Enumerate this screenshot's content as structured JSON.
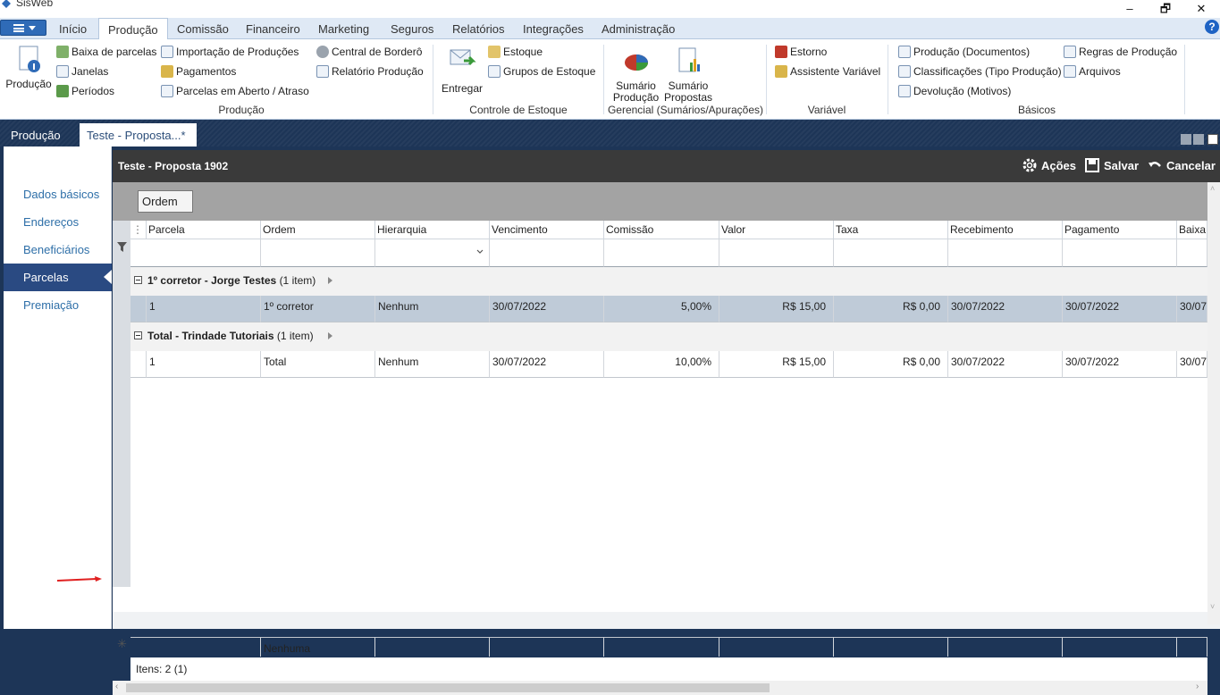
{
  "app": {
    "title": "SisWeb"
  },
  "window": {
    "minimize": "‒",
    "restore": "🗗",
    "close": "✕"
  },
  "ribbon_tabs": [
    "Início",
    "Produção",
    "Comissão",
    "Financeiro",
    "Marketing",
    "Seguros",
    "Relatórios",
    "Integrações",
    "Administração"
  ],
  "ribbon": {
    "producao_big": "Produção",
    "col1": [
      "Baixa de parcelas",
      "Janelas",
      "Períodos"
    ],
    "col2": [
      "Importação de Produções",
      "Pagamentos",
      "Parcelas em Aberto / Atraso"
    ],
    "col3": [
      "Central de Borderô",
      "Relatório Produção"
    ],
    "group_producao": "Produção",
    "entregar": "Entregar",
    "estoque": [
      "Estoque",
      "Grupos de Estoque"
    ],
    "group_estoque": "Controle de Estoque",
    "sumario_producao": [
      "Sumário",
      "Produção"
    ],
    "sumario_propostas": [
      "Sumário",
      "Propostas"
    ],
    "group_gerencial": "Gerencial (Sumários/Apurações)",
    "variavel": [
      "Estorno",
      "Assistente Variável"
    ],
    "group_variavel": "Variável",
    "basicos1": [
      "Produção (Documentos)",
      "Classificações (Tipo Produção)",
      "Devolução (Motivos)"
    ],
    "basicos2": [
      "Regras de Produção",
      "Arquivos"
    ],
    "group_basicos": "Básicos"
  },
  "doc_tabs": [
    "Produção",
    "Teste - Proposta...*"
  ],
  "sidebar": [
    "Dados básicos",
    "Endereços",
    "Beneficiários",
    "Parcelas",
    "Premiação"
  ],
  "header": {
    "title": "Teste - Proposta 1902",
    "acoes": "Ações",
    "salvar": "Salvar",
    "cancelar": "Cancelar"
  },
  "group_panel": {
    "button": "Ordem"
  },
  "columns": [
    "Parcela",
    "Ordem",
    "Hierarquia",
    "Vencimento",
    "Comissão",
    "Valor",
    "Taxa",
    "Recebimento",
    "Pagamento",
    "Baixa"
  ],
  "groups": [
    {
      "title": "1º corretor - Jorge Testes",
      "count": "(1 item)",
      "row": [
        "1",
        "1º corretor",
        "Nenhum",
        "30/07/2022",
        "5,00%",
        "R$ 15,00",
        "R$ 0,00",
        "30/07/2022",
        "30/07/2022",
        "30/07"
      ]
    },
    {
      "title": "Total - Trindade Tutoriais",
      "count": "(1 item)",
      "row": [
        "1",
        "Total",
        "Nenhum",
        "30/07/2022",
        "10,00%",
        "R$ 15,00",
        "R$ 0,00",
        "30/07/2022",
        "30/07/2022",
        "30/07"
      ]
    }
  ],
  "new_row": {
    "ordem": "Nenhuma"
  },
  "status": {
    "items": "Itens: 2 (1)"
  }
}
